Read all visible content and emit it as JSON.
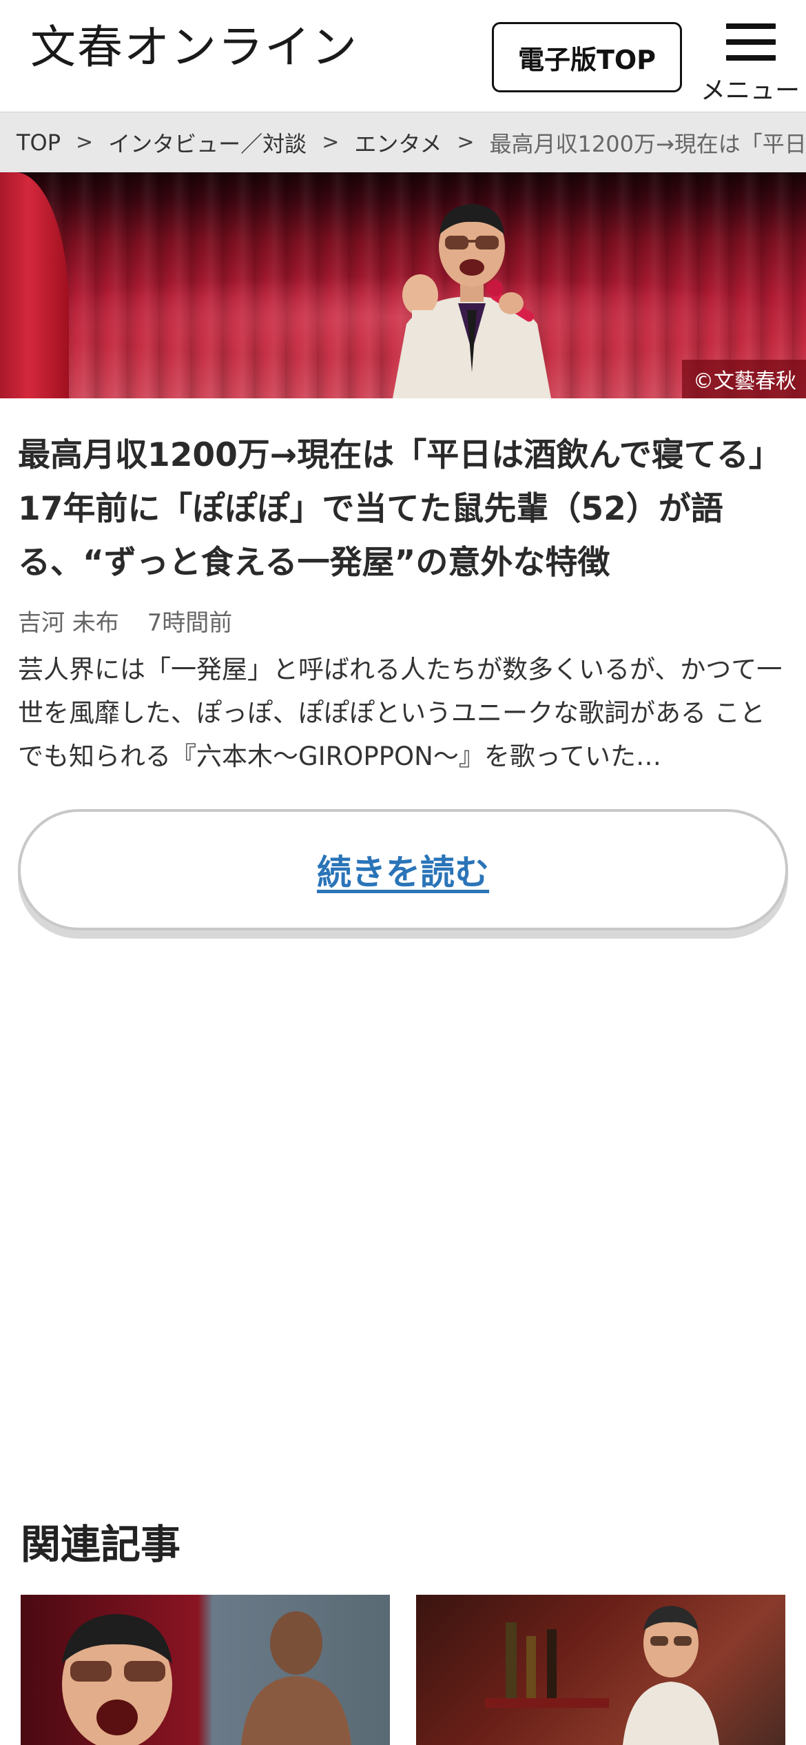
{
  "header": {
    "logo_text": "文春オンライン",
    "ebook_button": "電子版TOP",
    "menu_label": "メニュー"
  },
  "breadcrumb": {
    "items": [
      "TOP",
      "インタビュー／対談",
      "エンタメ",
      "最高月収1200万→現在は「平日は"
    ]
  },
  "hero": {
    "copyright": "©文藝春秋"
  },
  "article": {
    "title": "最高月収1200万→現在は「平日は酒飲んで寝てる」17年前に「ぽぽぽ」で当てた鼠先輩（52）が語る、“ずっと食える一発屋”の意外な特徴",
    "author": "吉河 未布",
    "time": "7時間前",
    "excerpt": "芸人界には「一発屋」と呼ばれる人たちが数多くいるが、かつて一世を風靡した、ぽっぽ、ぽぽぽというユニークな歌詞がある ことでも知られる『六本木〜GIROPPON〜』を歌っていた…",
    "read_more": "続きを読む"
  },
  "related": {
    "heading": "関連記事"
  },
  "colors": {
    "link_blue": "#2a74b8",
    "breadcrumb_bg": "#e8e8e8",
    "curtain_red": "#c42a40"
  }
}
